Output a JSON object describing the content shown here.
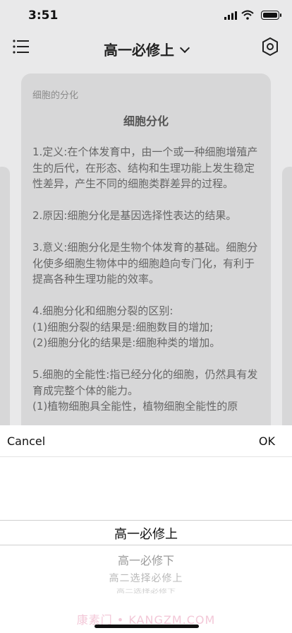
{
  "status": {
    "time": "3:51"
  },
  "nav": {
    "title": "高一必修上"
  },
  "card": {
    "category": "细胞的分化",
    "title": "细胞分化",
    "paragraphs": [
      "1.定义:在个体发育中，由一个或一种细胞增殖产生的后代，在形态、结构和生理功能上发生稳定性差异，产生不同的细胞类群差异的过程。",
      "2.原因:细胞分化是基因选择性表达的结果。",
      "3.意义:细胞分化是生物个体发育的基础。细胞分化使多细胞生物体中的细胞趋向专门化，有利于提高各种生理功能的效率。",
      "4.细胞分化和细胞分裂的区别:\n(1)细胞分裂的结果是:细胞数目的增加;\n(2)细胞分化的结果是:细胞种类的增加。",
      "5.细胞的全能性:指已经分化的细胞，仍然具有发育成完整个体的能力。\n(1)植物细胞具全能性，植物细胞全能性的原"
    ]
  },
  "picker": {
    "cancel_label": "Cancel",
    "ok_label": "OK",
    "options": [
      "高一必修上",
      "高一必修下",
      "高二选择必修上",
      "高二选择必修下"
    ],
    "selected_index": 0
  },
  "watermark": "康素门 • KANGZM.COM",
  "icons": {
    "menu": "menu-icon",
    "chevron": "chevron-down-icon",
    "settings": "settings-icon"
  }
}
